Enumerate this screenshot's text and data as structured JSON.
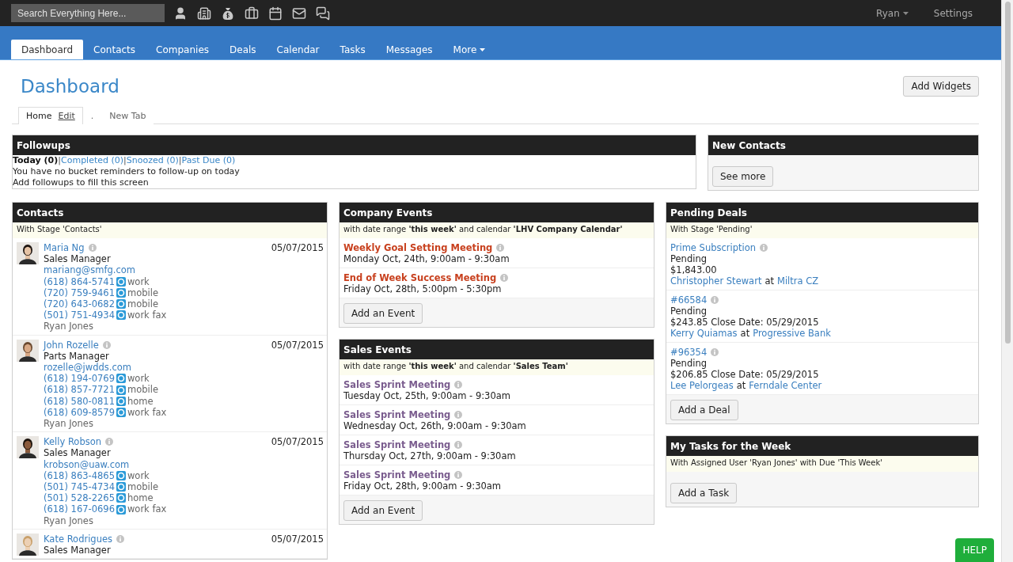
{
  "topbar": {
    "search": {
      "placeholder": "Search Everything Here..."
    },
    "user": "Ryan",
    "settings": "Settings"
  },
  "nav": [
    {
      "label": "Dashboard",
      "selected": true,
      "dropdown": false
    },
    {
      "label": "Contacts",
      "selected": false,
      "dropdown": false
    },
    {
      "label": "Companies",
      "selected": false,
      "dropdown": false
    },
    {
      "label": "Deals",
      "selected": false,
      "dropdown": false
    },
    {
      "label": "Calendar",
      "selected": false,
      "dropdown": false
    },
    {
      "label": "Tasks",
      "selected": false,
      "dropdown": false
    },
    {
      "label": "Messages",
      "selected": false,
      "dropdown": false
    },
    {
      "label": "More",
      "selected": false,
      "dropdown": true
    }
  ],
  "page": {
    "title": "Dashboard",
    "add_widgets": "Add Widgets"
  },
  "subtabs": [
    {
      "label": "Home",
      "edit": "Edit",
      "selected": true
    },
    {
      "label": ".",
      "selected": false
    },
    {
      "label": "New Tab",
      "selected": false
    }
  ],
  "followups": {
    "title": "Followups",
    "separator": "|",
    "filters": [
      {
        "label": "Today (0)",
        "selected": true
      },
      {
        "label": "Completed (0)",
        "selected": false
      },
      {
        "label": "Snoozed (0)",
        "selected": false
      },
      {
        "label": "Past Due (0)",
        "selected": false
      }
    ],
    "lines": [
      "You have no bucket reminders to follow-up on today",
      "Add followups to fill this screen"
    ]
  },
  "new_contacts": {
    "title": "New Contacts",
    "button": "See more"
  },
  "contacts": {
    "title": "Contacts",
    "filter": "With Stage 'Contacts'",
    "items": [
      {
        "name": "Maria Ng",
        "date": "05/07/2015",
        "job": "Sales Manager",
        "email": "mariang@smfg.com",
        "phones": [
          {
            "number": "(618) 864-5741",
            "label": "work"
          },
          {
            "number": "(720) 759-9461",
            "label": "mobile"
          },
          {
            "number": "(720) 643-0682",
            "label": "mobile"
          },
          {
            "number": "(501) 751-4934",
            "label": "work fax"
          }
        ],
        "owner": "Ryan Jones"
      },
      {
        "name": "John Rozelle",
        "date": "05/07/2015",
        "job": "Parts Manager",
        "email": "rozelle@jwdds.com",
        "phones": [
          {
            "number": "(618) 194-0769",
            "label": "work"
          },
          {
            "number": "(618) 857-7721",
            "label": "mobile"
          },
          {
            "number": "(618) 580-0811",
            "label": "home"
          },
          {
            "number": "(618) 609-8579",
            "label": "work fax"
          }
        ],
        "owner": "Ryan Jones"
      },
      {
        "name": "Kelly Robson",
        "date": "05/07/2015",
        "job": "Sales Manager",
        "email": "krobson@uaw.com",
        "phones": [
          {
            "number": "(618) 863-4865",
            "label": "work"
          },
          {
            "number": "(501) 745-4734",
            "label": "mobile"
          },
          {
            "number": "(501) 528-2265",
            "label": "home"
          },
          {
            "number": "(618) 167-0696",
            "label": "work fax"
          }
        ],
        "owner": "Ryan Jones"
      },
      {
        "name": "Kate Rodrigues",
        "date": "05/07/2015",
        "job": "Sales Manager"
      }
    ]
  },
  "company_events": {
    "title": "Company Events",
    "filter": "with date range **'this week'** and calendar **'LHV Company Calendar'**",
    "button": "Add an Event",
    "items": [
      {
        "title": "Weekly Goal Setting Meeting",
        "when": "Monday Oct, 24th, 9:00am - 9:30am",
        "color": "#c8401e"
      },
      {
        "title": "End of Week Success Meeting",
        "when": "Friday Oct, 28th, 5:00pm - 5:30pm",
        "color": "#c8401e"
      }
    ]
  },
  "sales_events": {
    "title": "Sales Events",
    "filter": "with date range **'this week'** and calendar **'Sales Team'**",
    "button": "Add an Event",
    "items": [
      {
        "title": "Sales Sprint Meeting",
        "when": "Tuesday Oct, 25th, 9:00am - 9:30am",
        "color": "#7a5c8e"
      },
      {
        "title": "Sales Sprint Meeting",
        "when": "Wednesday Oct, 26th, 9:00am - 9:30am",
        "color": "#7a5c8e"
      },
      {
        "title": "Sales Sprint Meeting",
        "when": "Thursday Oct, 27th, 9:00am - 9:30am",
        "color": "#7a5c8e"
      },
      {
        "title": "Sales Sprint Meeting",
        "when": "Friday Oct, 28th, 9:00am - 9:30am",
        "color": "#7a5c8e"
      }
    ]
  },
  "pending_deals": {
    "title": "Pending Deals",
    "filter": "With Stage 'Pending'",
    "button": "Add a Deal",
    "items": [
      {
        "name": "Prime Subscription",
        "stage": "Pending",
        "amount": "$1,843.00",
        "contact": "Christopher Stewart",
        "at": "at",
        "company": "Miltra CZ"
      },
      {
        "name": "#66584",
        "stage": "Pending",
        "amount": "$243.85 Close Date: 05/29/2015",
        "contact": "Kerry Quiamas",
        "at": "at",
        "company": "Progressive Bank"
      },
      {
        "name": "#96354",
        "stage": "Pending",
        "amount": "$206.85 Close Date: 05/29/2015",
        "contact": "Lee Pelorgeas",
        "at": "at",
        "company": "Ferndale Center"
      }
    ]
  },
  "tasks": {
    "title": "My Tasks for the Week",
    "filter": "With Assigned User 'Ryan Jones' with Due 'This Week'",
    "button": "Add a Task"
  },
  "help": "HELP"
}
